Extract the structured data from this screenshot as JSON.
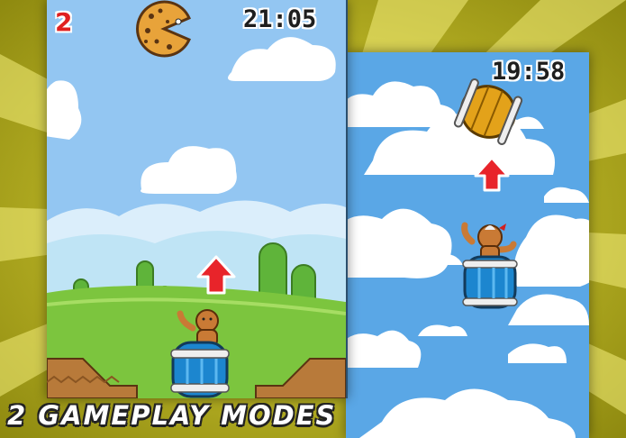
{
  "caption": "2 GAMEPLAY MODES",
  "left_mode": {
    "score": "2",
    "timer": "21:05",
    "target": "cookie-icon",
    "player": "gingerbread-man",
    "vehicle": "blue-barrel-cannon",
    "direction": "arrow-up-icon"
  },
  "right_mode": {
    "timer": "19:58",
    "target": "wooden-barrel-icon",
    "player": "gingerbread-girl",
    "vehicle": "blue-barrel-cannon",
    "direction": "arrow-up-icon"
  },
  "colors": {
    "backdrop_yellow": "#c9c41c",
    "sky_light": "#93c6f2",
    "sky_deep": "#5aa7e6",
    "grass": "#7cc53e",
    "arrow_red": "#e8242a",
    "barrel_blue": "#1c86cf",
    "barrel_wood": "#e3a21a",
    "score_red": "#e02020"
  }
}
